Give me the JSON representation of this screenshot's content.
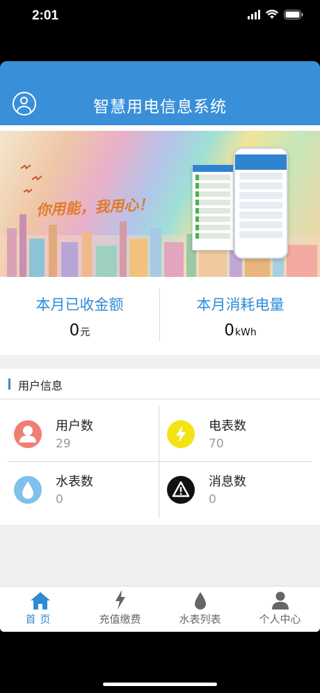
{
  "status_bar": {
    "time": "2:01"
  },
  "header": {
    "title": "智慧用电信息系统",
    "avatar_icon": "user-circle-icon"
  },
  "banner": {
    "slogan": "你用能，我用心！"
  },
  "stats": [
    {
      "label": "本月已收金额",
      "value": "0",
      "unit": "元"
    },
    {
      "label": "本月消耗电量",
      "value": "0",
      "unit": "kWh"
    }
  ],
  "user_info": {
    "title": "用户信息",
    "items": [
      {
        "label": "用户数",
        "value": "29",
        "icon": "user-icon",
        "color": "#ef7f72"
      },
      {
        "label": "电表数",
        "value": "70",
        "icon": "lightning-icon",
        "color": "#f2e315"
      },
      {
        "label": "水表数",
        "value": "0",
        "icon": "water-drop-icon",
        "color": "#7ec1ea"
      },
      {
        "label": "消息数",
        "value": "0",
        "icon": "warning-icon",
        "color": "#111111"
      }
    ]
  },
  "tabs": [
    {
      "label": "首页",
      "icon": "home-icon",
      "active": true
    },
    {
      "label": "充值缴费",
      "icon": "lightning-icon",
      "active": false
    },
    {
      "label": "水表列表",
      "icon": "water-drop-icon",
      "active": false
    },
    {
      "label": "个人中心",
      "icon": "person-icon",
      "active": false
    }
  ],
  "colors": {
    "primary": "#3a8fd9",
    "accent": "#2f8bd6"
  }
}
